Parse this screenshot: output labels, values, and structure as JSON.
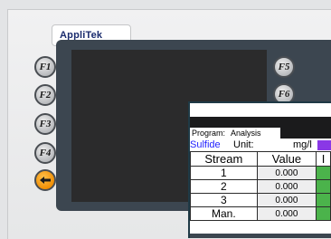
{
  "device": {
    "brand": "AppliTek"
  },
  "function_keys": [
    {
      "label": "F1"
    },
    {
      "label": "F2"
    },
    {
      "label": "F3"
    },
    {
      "label": "F4"
    },
    {
      "label": "F5"
    },
    {
      "label": "F6"
    }
  ],
  "back_key": {
    "icon": "arrow-left-icon",
    "color": "#f08c00"
  },
  "lcd": {
    "program_label": "Program:",
    "program_value": "Analysis",
    "analyte": "Sulfide",
    "unit_label": "Unit:",
    "unit_value": "mg/l",
    "swatch_color": "#8a38e6",
    "table": {
      "headers": [
        "Stream",
        "Value",
        "I"
      ],
      "rows": [
        {
          "stream": "1",
          "value": "0.000"
        },
        {
          "stream": "2",
          "value": "0.000"
        },
        {
          "stream": "3",
          "value": "0.000"
        },
        {
          "stream": "Man.",
          "value": "0.000"
        }
      ]
    }
  }
}
